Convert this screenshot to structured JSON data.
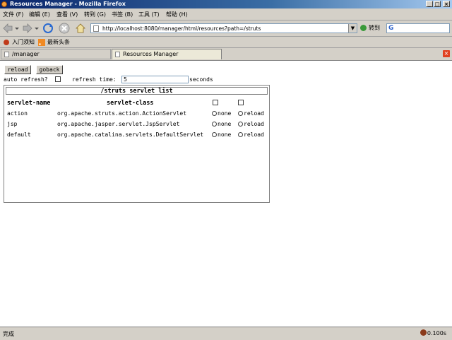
{
  "window": {
    "title": "Resources Manager - Mozilla Firefox",
    "minimize": "_",
    "maximize": "□",
    "close": "×"
  },
  "menu": [
    "文件 (F)",
    "编辑 (E)",
    "查看 (V)",
    "转到 (G)",
    "书签 (B)",
    "工具 (T)",
    "帮助 (H)"
  ],
  "nav": {
    "url": "http://localhost:8080/manager/html/resources?path=/struts",
    "go_label": "转到",
    "search_glyph": "G"
  },
  "bookmarks": [
    "入门须知",
    "最新头条"
  ],
  "tabs": [
    "/manager",
    "Resources Manager"
  ],
  "page": {
    "reload_label": "reload",
    "goback_label": "goback",
    "auto_refresh_label": "auto refresh?",
    "refresh_time_label": "refresh time:",
    "refresh_time_value": "5",
    "seconds_label": "seconds",
    "table_title": "/struts servlet list",
    "col_name": "servlet-name",
    "col_class": "servlet-class",
    "none_label": "none",
    "reload_opt": "reload",
    "rows": [
      {
        "name": "action",
        "class": "org.apache.struts.action.ActionServlet"
      },
      {
        "name": "jsp",
        "class": "org.apache.jasper.servlet.JspServlet"
      },
      {
        "name": "default",
        "class": "org.apache.catalina.servlets.DefaultServlet"
      }
    ]
  },
  "status": {
    "text": "完成",
    "timing": "0.100s"
  }
}
